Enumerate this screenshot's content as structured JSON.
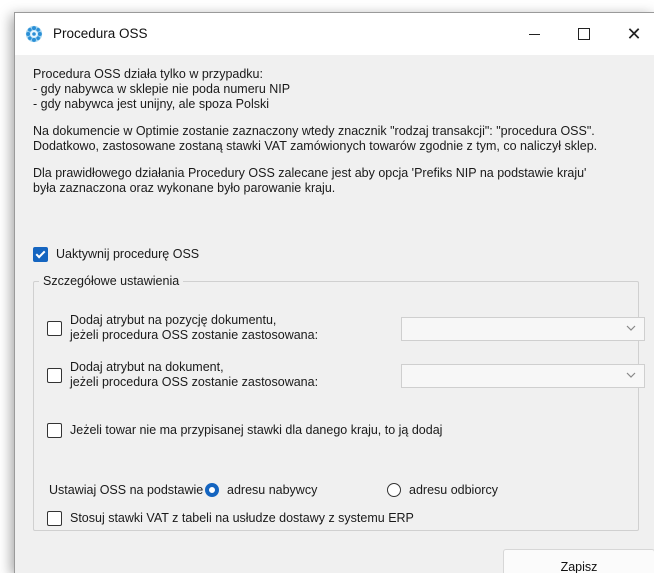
{
  "window": {
    "title": "Procedura OSS",
    "icon": "gear-icon",
    "controls": {
      "minimize": "minimize-icon",
      "maximize": "maximize-icon",
      "close": "close-icon"
    }
  },
  "info": {
    "line1": "Procedura OSS działa tylko w przypadku:",
    "line2": "- gdy nabywca w sklepie nie poda numeru NIP",
    "line3": "- gdy nabywca jest unijny, ale spoza Polski",
    "line4": "Na dokumencie w Optimie zostanie zaznaczony wtedy znacznik \"rodzaj transakcji\": \"procedura OSS\".",
    "line5": "Dodatkowo, zastosowane zostaną stawki VAT zamówionych towarów zgodnie z tym, co naliczył sklep.",
    "line6": "Dla prawidłowego działania Procedury OSS zalecane jest aby opcja 'Prefiks NIP na podstawie kraju'",
    "line7": "była zaznaczona oraz wykonane było parowanie kraju."
  },
  "activate": {
    "label": "Uaktywnij procedurę OSS",
    "checked": true
  },
  "details": {
    "legend": "Szczegółowe ustawienia",
    "option1": {
      "line1": "Dodaj atrybut na pozycję dokumentu,",
      "line2": "jeżeli procedura OSS zostanie zastosowana:",
      "checked": false,
      "combo_value": ""
    },
    "option2": {
      "line1": "Dodaj atrybut na dokument,",
      "line2": "jeżeli procedura OSS zostanie zastosowana:",
      "checked": false,
      "combo_value": ""
    },
    "option3": {
      "label": "Jeżeli towar nie ma przypisanej stawki dla danego kraju, to ją dodaj",
      "checked": false
    },
    "oss_basis": {
      "label": "Ustawiaj OSS na podstawie",
      "options": [
        "adresu nabywcy",
        "adresu odbiorcy"
      ],
      "selected": "adresu nabywcy"
    },
    "option4": {
      "label": "Stosuj stawki VAT z tabeli na usłudze dostawy z systemu ERP",
      "checked": false
    }
  },
  "footer": {
    "save_label": "Zapisz"
  },
  "colors": {
    "accent": "#1565c0",
    "window_bg": "#f0f0f0"
  }
}
